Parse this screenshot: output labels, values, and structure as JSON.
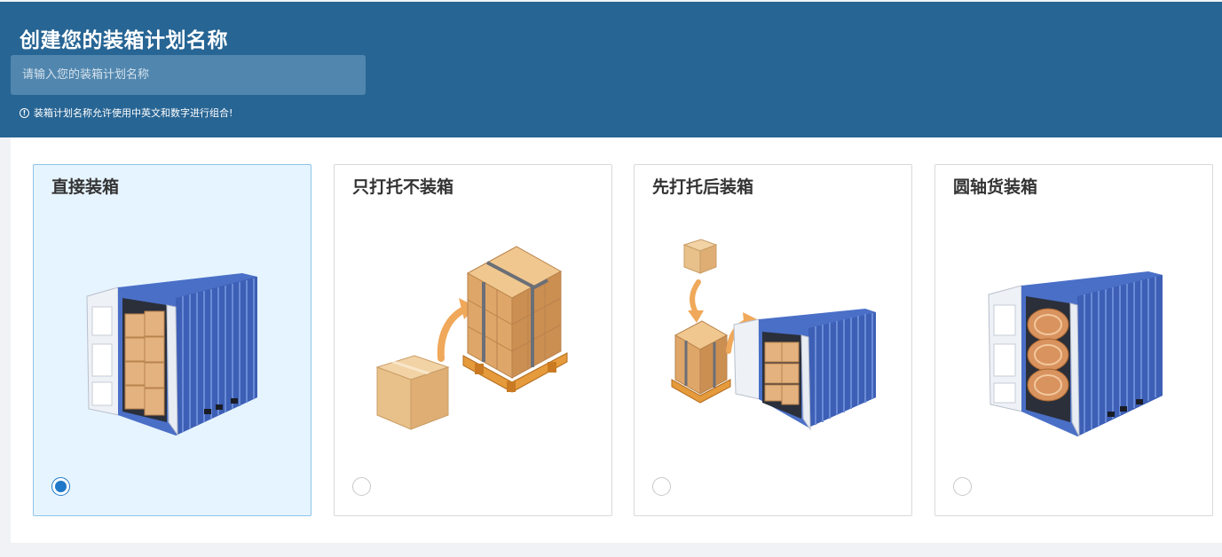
{
  "header": {
    "title": "创建您的装箱计划名称",
    "input_placeholder": "请输入您的装箱计划名称",
    "input_value": "",
    "hint": "装箱计划名称允许使用中英文和数字进行组合!",
    "hint_icon": "info-circle-icon",
    "background": "#276594"
  },
  "options": [
    {
      "title": "直接装箱",
      "image": "container-with-boxes",
      "selected": true
    },
    {
      "title": "只打托不装箱",
      "image": "box-to-pallet",
      "selected": false
    },
    {
      "title": "先打托后装箱",
      "image": "pallet-then-container",
      "selected": false
    },
    {
      "title": "圆轴货装箱",
      "image": "container-with-rolls",
      "selected": false
    }
  ],
  "colors": {
    "accent": "#1f78c8",
    "selected_bg": "#e6f4ff",
    "container_blue": "#4a6fc7",
    "box_tan": "#e3b27f"
  }
}
